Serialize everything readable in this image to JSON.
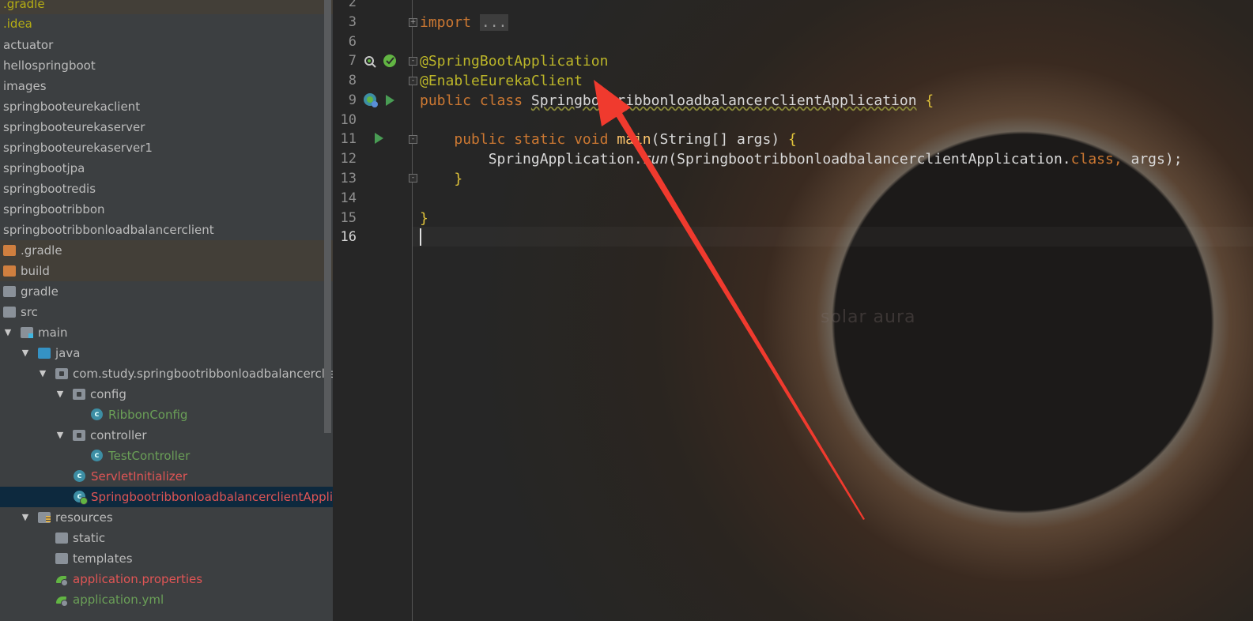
{
  "project_tree": {
    "rows": [
      {
        "label": ".gradle",
        "color": "#b4ad14",
        "bg": "ignored"
      },
      {
        "label": ".idea",
        "color": "#b4ad14"
      },
      {
        "label": "actuator"
      },
      {
        "label": "hellospringboot"
      },
      {
        "label": "images"
      },
      {
        "label": "springbooteurekaclient"
      },
      {
        "label": "springbooteurekaserver"
      },
      {
        "label": "springbooteurekaserver1"
      },
      {
        "label": "springbootjpa"
      },
      {
        "label": "springbootredis"
      },
      {
        "label": "springbootribbon"
      },
      {
        "label": "springbootribbonloadbalancerclient"
      },
      {
        "label": ".gradle",
        "icon": "folder-orange-icon",
        "bg": "ignored"
      },
      {
        "label": "build",
        "icon": "folder-orange-icon",
        "bg": "ignored"
      },
      {
        "label": "gradle",
        "icon": "folder-icon"
      },
      {
        "label": "src",
        "icon": "folder-icon"
      },
      {
        "label": "main",
        "icon": "source-folder-icon",
        "expanded": true
      },
      {
        "label": "java",
        "icon": "java-folder-icon",
        "expanded": true
      },
      {
        "label": "com.study.springbootribbonloadbalancerclient",
        "icon": "package-icon",
        "expanded": true
      },
      {
        "label": "config",
        "icon": "package-icon",
        "expanded": true
      },
      {
        "label": "RibbonConfig",
        "icon": "class-icon",
        "color": "#62b543"
      },
      {
        "label": "controller",
        "icon": "package-icon",
        "expanded": true
      },
      {
        "label": "TestController",
        "icon": "class-icon",
        "color": "#62b543"
      },
      {
        "label": "ServletInitializer",
        "icon": "class-icon",
        "color": "#e05555"
      },
      {
        "label": "SpringbootribbonloadbalancerclientApplication",
        "icon": "spring-class-icon",
        "color": "#e05555",
        "selected": true
      },
      {
        "label": "resources",
        "icon": "resources-folder-icon",
        "expanded": true
      },
      {
        "label": "static",
        "icon": "folder-icon"
      },
      {
        "label": "templates",
        "icon": "folder-icon"
      },
      {
        "label": "application.properties",
        "icon": "spring-config-icon",
        "color": "#e05555"
      },
      {
        "label": "application.yml",
        "icon": "spring-config-icon",
        "color": "#62b543"
      }
    ]
  },
  "editor": {
    "line_numbers": [
      "2",
      "3",
      "6",
      "7",
      "8",
      "9",
      "10",
      "11",
      "12",
      "13",
      "14",
      "15",
      "16"
    ],
    "current_line": "16",
    "code": {
      "l3_kw": "import",
      "l3_fold": "...",
      "l7": "@SpringBootApplication",
      "l8": "@EnableEurekaClient",
      "l9_kw": "public class",
      "l9_name": "SpringbootribbonloadbalancerclientApplication",
      "l9_brace": "{",
      "l11_kw": "public static void",
      "l11_fn": "main",
      "l11_sig": "(String[] args)",
      "l11_brace": "{",
      "l12_cls": "SpringApplication.",
      "l12_run": "run",
      "l12_args": "(SpringbootribbonloadbalancerclientApplication.",
      "l12_kw": "class,",
      "l12_end": " args);",
      "l13": "}",
      "l15": "}"
    },
    "watermark": "solar aura"
  },
  "colors": {
    "arrow": "#f03a2e",
    "selection": "#0d293e",
    "keyword": "#cc7832",
    "annotation": "#bbb529"
  }
}
